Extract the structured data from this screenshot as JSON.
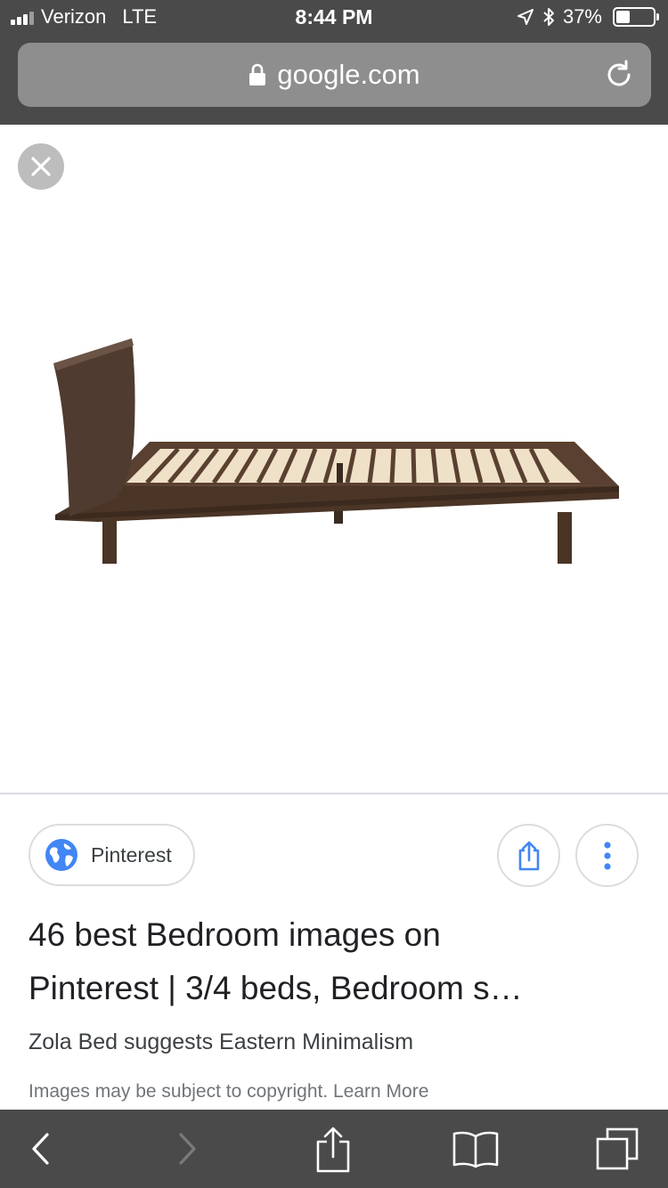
{
  "status_bar": {
    "carrier": "Verizon",
    "network": "LTE",
    "time": "8:44 PM",
    "battery": "37%",
    "battery_level": 0.37,
    "signal_bars": 3,
    "icons": [
      "signal-icon",
      "location-arrow-icon",
      "bluetooth-icon",
      "battery-icon"
    ]
  },
  "address_bar": {
    "domain": "google.com",
    "icons": [
      "lock-icon",
      "reload-icon"
    ]
  },
  "viewer": {
    "close_icon": "close-icon",
    "image_subject": "bed-image"
  },
  "result": {
    "source": "Pinterest",
    "source_icon": "globe-icon",
    "title_line1": "46 best Bedroom images on",
    "title_line2": "Pinterest | 3/4 beds, Bedroom s…",
    "subtitle": "Zola Bed suggests Eastern Minimalism",
    "copyright": "Images may be subject to copyright. Learn More",
    "action_icons": [
      "share-icon",
      "more-vert-icon"
    ]
  },
  "toolbar": {
    "icons": [
      "back-icon",
      "forward-icon",
      "share-icon",
      "bookmarks-icon",
      "tabs-icon"
    ]
  },
  "colors": {
    "chrome": "#4a4a4a",
    "address_bar": "#8e8e8e",
    "accent_blue": "#4285f4",
    "chip_border": "#dadce0"
  }
}
